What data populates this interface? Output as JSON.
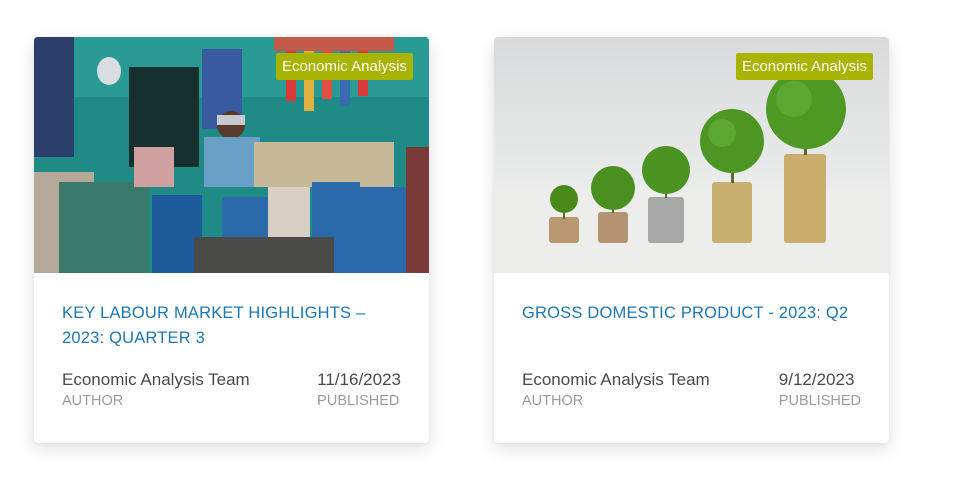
{
  "cards": [
    {
      "badge": "Economic Analysis",
      "title": "KEY LABOUR MARKET HIGHLIGHTS – 2023: QUARTER 3",
      "author": "Economic Analysis Team",
      "author_label": "AUTHOR",
      "date": "11/16/2023",
      "date_label": "PUBLISHED",
      "image": "market-vendor-photo"
    },
    {
      "badge": "Economic Analysis",
      "title": "GROSS DOMESTIC PRODUCT - 2023: Q2",
      "author": "Economic Analysis Team",
      "author_label": "AUTHOR",
      "date": "9/12/2023",
      "date_label": "PUBLISHED",
      "image": "growing-coins-photo"
    }
  ],
  "colors": {
    "badge": "#a8b400",
    "title": "#1b78b8",
    "meta_value": "#4a4a4a",
    "meta_label": "#9a9aa4"
  }
}
